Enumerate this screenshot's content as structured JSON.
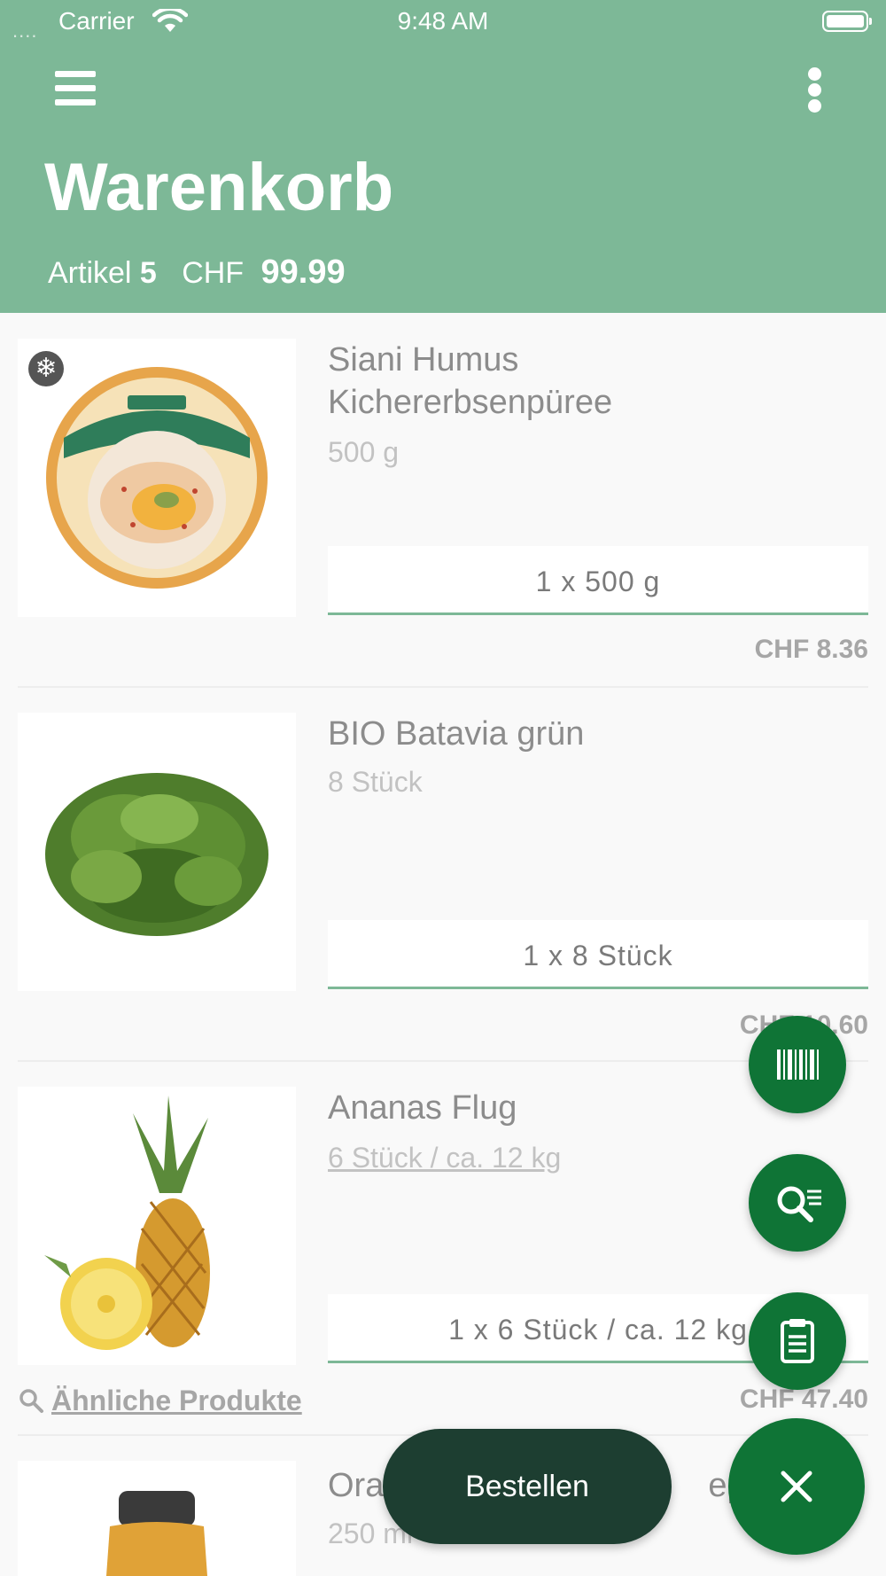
{
  "status_bar": {
    "signal": "....",
    "carrier": "Carrier",
    "time": "9:48 AM"
  },
  "header": {
    "title": "Warenkorb",
    "articles_label": "Artikel",
    "articles_count": "5",
    "currency": "CHF",
    "total": "99.99",
    "bg_color": "#7db897"
  },
  "items": [
    {
      "name_line1": "Siani Humus",
      "name_line2": "Kichererbsenpüree",
      "unit": "500 g",
      "quantity": "1 x 500 g",
      "price": "CHF 8.36",
      "frozen": true,
      "image": "hummus-tub"
    },
    {
      "name_line1": "BIO Batavia grün",
      "unit": "8 Stück",
      "quantity": "1 x 8 Stück",
      "price": "CHF 10.60",
      "image": "batavia-lettuce"
    },
    {
      "name_line1": "Ananas Flug",
      "unit": "6 Stück / ca. 12 kg",
      "quantity": "1 x 6 Stück / ca. 12 kg",
      "price": "CHF 47.40",
      "image": "pineapple",
      "similar_label": "Ähnliche Produkte"
    },
    {
      "name_line1": "Ora",
      "name_suffix": "epre",
      "unit": "250 ml",
      "image": "juice-bottle"
    }
  ],
  "fab": {
    "barcode": "barcode-icon",
    "search_list": "search-list-icon",
    "clipboard": "clipboard-icon",
    "close": "close-icon",
    "color": "#0f7436"
  },
  "order_button": {
    "label": "Bestellen",
    "color": "#1d3e31"
  }
}
